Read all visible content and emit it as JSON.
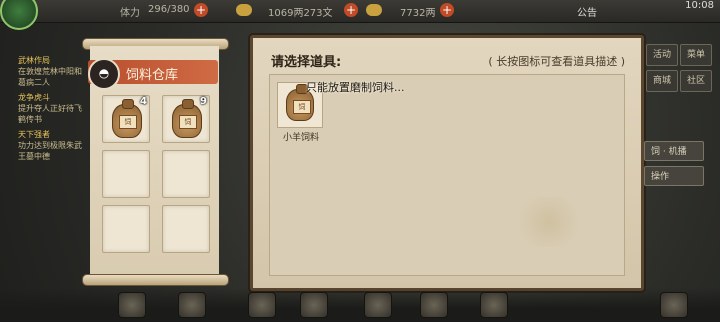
{
  "topbar": {
    "stamina_label": "体力",
    "stamina_value": "296/380",
    "money_value": "1069两273文",
    "gold_value": "7732两",
    "announcement": "公告",
    "time": "10:08"
  },
  "notices": [
    {
      "title": "武林作局",
      "text": "在敦煌荒林中阳和葛病二人"
    },
    {
      "title": "龙争虎斗",
      "text": "提升夺人正好待飞鹤传书"
    },
    {
      "title": "天下强者",
      "text": "功力达到极限朱武王墓中德"
    }
  ],
  "warehouse": {
    "title": "饲料仓库",
    "slots": [
      {
        "has_item": true,
        "count": "4",
        "label": "饲"
      },
      {
        "has_item": true,
        "count": "9",
        "label": "饲"
      },
      {
        "has_item": false,
        "count": ""
      },
      {
        "has_item": false,
        "count": ""
      },
      {
        "has_item": false,
        "count": ""
      },
      {
        "has_item": false,
        "count": ""
      }
    ]
  },
  "selection": {
    "title": "请选择道具:",
    "hint": "( 长按图标可查看道具描述 )",
    "tooltip": "只能放置磨制饲料...",
    "items": [
      {
        "name": "小羊饲料",
        "label": "饲"
      }
    ]
  },
  "right_menu": {
    "buttons": [
      "活动",
      "菜单",
      "商城",
      "社区"
    ],
    "tabs": [
      "饲 · 机播",
      "操作"
    ]
  },
  "colors": {
    "panel_parchment": "#e2d6bf",
    "warehouse_header": "#c85e38",
    "panel_border": "#5b4630"
  }
}
